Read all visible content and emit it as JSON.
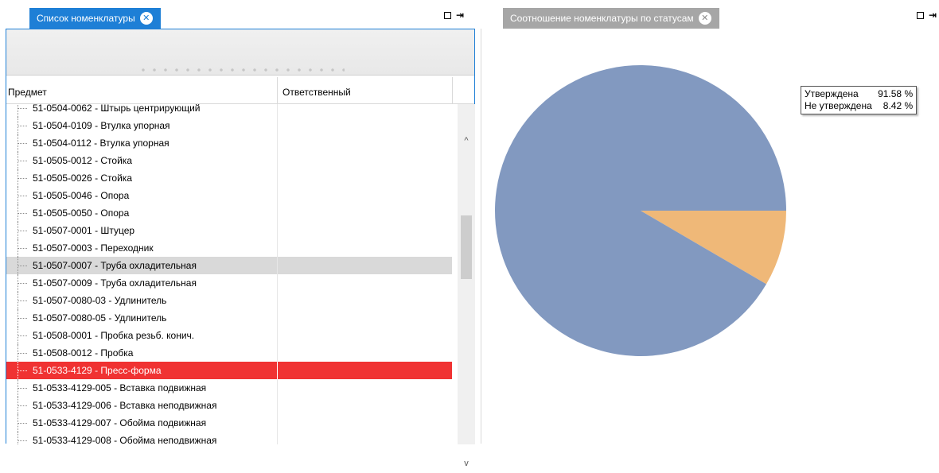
{
  "left_tab": {
    "title": "Список номенклатуры",
    "close": "✕"
  },
  "right_tab": {
    "title": "Соотношение номенклатуры по статусам",
    "close": "✕"
  },
  "window_controls": {
    "restore": "□",
    "pin": "⇥"
  },
  "grid": {
    "columns": [
      "Предмет",
      "Ответственный"
    ],
    "rows": [
      {
        "item": "51-0504-0062 - Штырь центрирующий",
        "responsible": "",
        "state": "clipped"
      },
      {
        "item": "51-0504-0109 - Втулка упорная",
        "responsible": "",
        "state": ""
      },
      {
        "item": "51-0504-0112 - Втулка упорная",
        "responsible": "",
        "state": ""
      },
      {
        "item": "51-0505-0012 - Стойка",
        "responsible": "",
        "state": ""
      },
      {
        "item": "51-0505-0026 - Стойка",
        "responsible": "",
        "state": ""
      },
      {
        "item": "51-0505-0046 - Опора",
        "responsible": "",
        "state": ""
      },
      {
        "item": "51-0505-0050 - Опора",
        "responsible": "",
        "state": ""
      },
      {
        "item": "51-0507-0001 - Штуцер",
        "responsible": "",
        "state": ""
      },
      {
        "item": "51-0507-0003 - Переходник",
        "responsible": "",
        "state": ""
      },
      {
        "item": "51-0507-0007 - Труба охладительная",
        "responsible": "",
        "state": "selected"
      },
      {
        "item": "51-0507-0009 - Труба охладительная",
        "responsible": "",
        "state": ""
      },
      {
        "item": "51-0507-0080-03 - Удлинитель",
        "responsible": "",
        "state": ""
      },
      {
        "item": "51-0507-0080-05 - Удлинитель",
        "responsible": "",
        "state": ""
      },
      {
        "item": "51-0508-0001 - Пробка резьб. конич.",
        "responsible": "",
        "state": ""
      },
      {
        "item": "51-0508-0012 - Пробка",
        "responsible": "",
        "state": ""
      },
      {
        "item": "51-0533-4129 - Пресс-форма",
        "responsible": "",
        "state": "highlighted"
      },
      {
        "item": "51-0533-4129-005 - Вставка подвижная",
        "responsible": "",
        "state": ""
      },
      {
        "item": "51-0533-4129-006 - Вставка неподвижная",
        "responsible": "",
        "state": ""
      },
      {
        "item": "51-0533-4129-007 - Обойма подвижная",
        "responsible": "",
        "state": ""
      },
      {
        "item": "51-0533-4129-008 - Обойма неподвижная",
        "responsible": "",
        "state": ""
      }
    ]
  },
  "scrollbar": {
    "up": "^",
    "down": "v"
  },
  "chart_data": {
    "type": "pie",
    "slices": [
      {
        "label": "Утверждена",
        "value": 91.58,
        "display": "91.58 %",
        "color": "#8299c0"
      },
      {
        "label": "Не утверждена",
        "value": 8.42,
        "display": "8.42 %",
        "color": "#efb878"
      }
    ],
    "legend_position": "top-right"
  },
  "colors": {
    "accent": "#1e7fd6",
    "selected_row": "#d9d9d9",
    "highlight_row": "#f03232"
  }
}
